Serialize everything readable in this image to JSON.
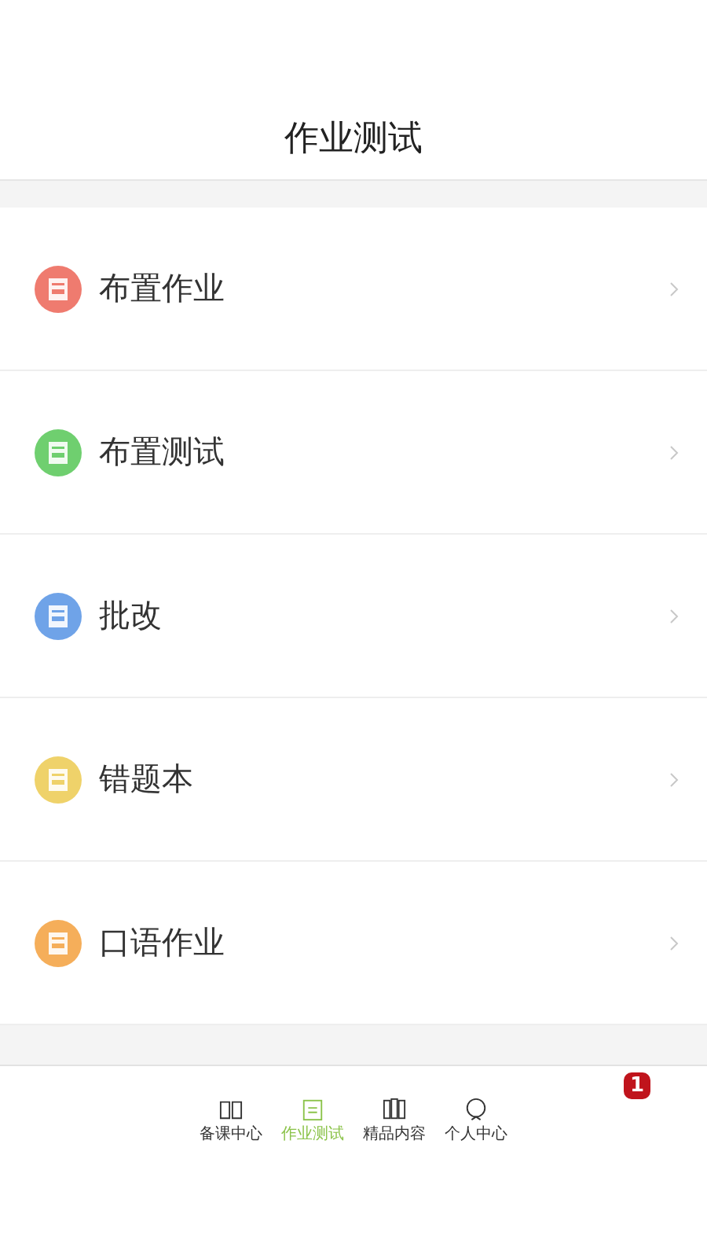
{
  "header": {
    "title": "作业测试"
  },
  "menu": [
    {
      "label": "布置作业",
      "color": "#ef7b6f"
    },
    {
      "label": "布置测试",
      "color": "#6fcf6f"
    },
    {
      "label": "批改",
      "color": "#6fa3e8"
    },
    {
      "label": "错题本",
      "color": "#efd26a"
    },
    {
      "label": "口语作业",
      "color": "#f5ae5a"
    }
  ],
  "tabbar": {
    "tabs": [
      {
        "label": "备课中心",
        "kind": "book",
        "selected": false
      },
      {
        "label": "作业测试",
        "kind": "clipboard",
        "selected": true
      },
      {
        "label": "精品内容",
        "kind": "books",
        "selected": false
      },
      {
        "label": "个人中心",
        "kind": "person",
        "selected": false
      }
    ],
    "badge": "1"
  }
}
